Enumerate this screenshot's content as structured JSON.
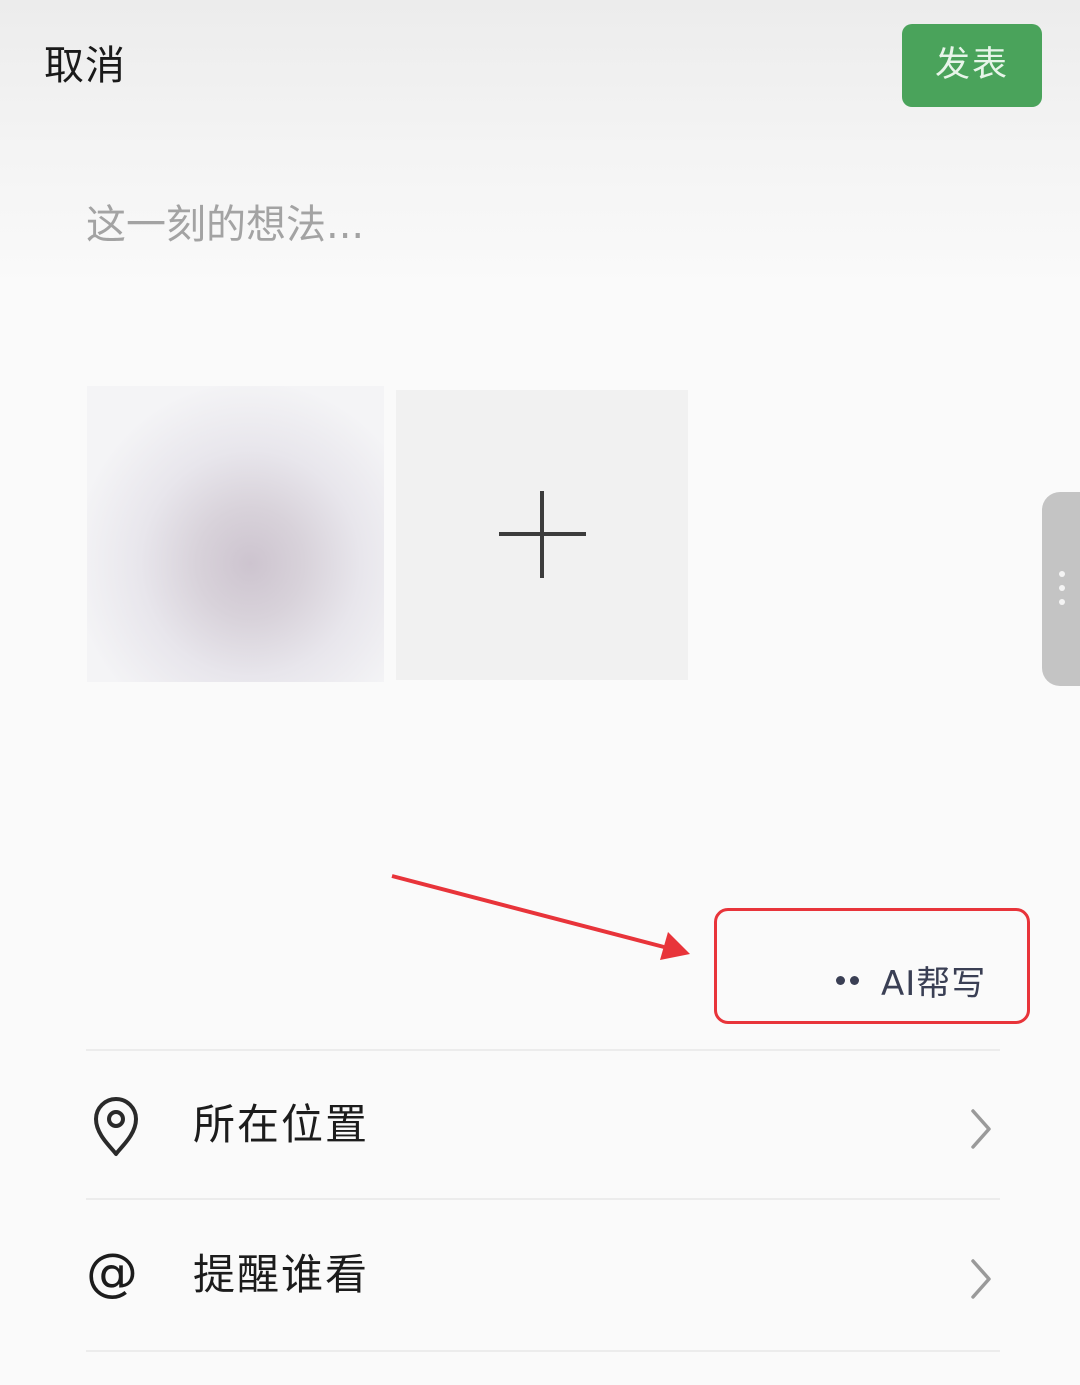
{
  "header": {
    "cancel_label": "取消",
    "publish_label": "发表",
    "publish_color": "#4aa35b"
  },
  "composer": {
    "placeholder": "这一刻的想法..."
  },
  "media": {
    "add_icon": "plus-icon"
  },
  "ai_assist": {
    "label": "AI帮写",
    "icon": "dots-icon"
  },
  "options": [
    {
      "label": "所在位置",
      "icon": "location-pin-icon"
    },
    {
      "label": "提醒谁看",
      "icon": "at-sign-icon",
      "glyph": "@"
    }
  ],
  "annotation": {
    "color": "#e8343a"
  }
}
